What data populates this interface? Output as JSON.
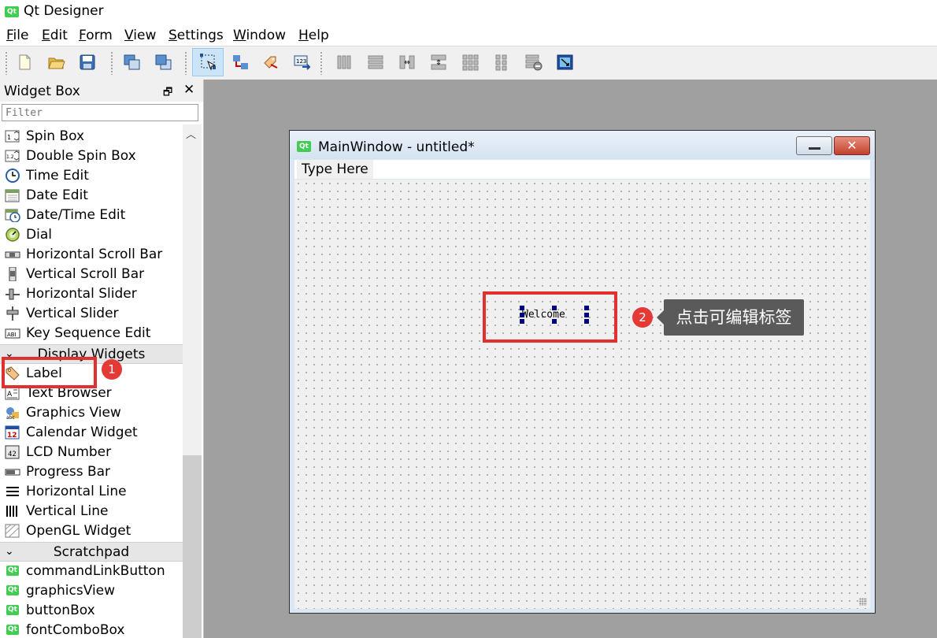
{
  "app": {
    "title": "Qt Designer",
    "logo": "Qt"
  },
  "menubar": {
    "items": [
      {
        "mnemonic": "F",
        "rest": "ile"
      },
      {
        "mnemonic": "E",
        "rest": "dit"
      },
      {
        "mnemonic": "F",
        "rest": "orm"
      },
      {
        "mnemonic": "V",
        "rest": "iew"
      },
      {
        "mnemonic": "S",
        "rest": "ettings"
      },
      {
        "mnemonic": "W",
        "rest": "indow"
      },
      {
        "mnemonic": "H",
        "rest": "elp"
      }
    ]
  },
  "toolbar": {
    "buttons": [
      "new-form-icon",
      "open-folder-icon",
      "save-icon",
      "send-to-back-icon",
      "bring-to-front-icon",
      "edit-widgets-icon",
      "edit-signals-slots-icon",
      "edit-buddies-icon",
      "edit-tab-order-icon",
      "layout-horizontal-icon",
      "layout-vertical-icon",
      "layout-horizontal-splitter-icon",
      "layout-vertical-splitter-icon",
      "layout-grid-icon",
      "layout-form-icon",
      "break-layout-icon",
      "adjust-size-icon"
    ],
    "active": "edit-widgets-icon"
  },
  "widget_box": {
    "title": "Widget Box",
    "float_glyph": "🗗",
    "close_glyph": "✕",
    "filter_placeholder": "Filter",
    "input_items": [
      "Spin Box",
      "Double Spin Box",
      "Time Edit",
      "Date Edit",
      "Date/Time Edit",
      "Dial",
      "Horizontal Scroll Bar",
      "Vertical Scroll Bar",
      "Horizontal Slider",
      "Vertical Slider",
      "Key Sequence Edit"
    ],
    "display_category": "Display Widgets",
    "display_items": [
      "Label",
      "Text Browser",
      "Graphics View",
      "Calendar Widget",
      "LCD Number",
      "Progress Bar",
      "Horizontal Line",
      "Vertical Line",
      "OpenGL Widget"
    ],
    "scratchpad_category": "Scratchpad",
    "scratchpad_items": [
      "commandLinkButton",
      "graphicsView",
      "buttonBox",
      "fontComboBox"
    ]
  },
  "form": {
    "title": "MainWindow - untitled*",
    "logo": "Qt",
    "close_glyph": "✕",
    "menu_placeholder": "Type Here",
    "label_text": "Welcome"
  },
  "annotations": {
    "badge1": "1",
    "badge2": "2",
    "tooltip": "点击可编辑标签",
    "color": "#e03030"
  }
}
